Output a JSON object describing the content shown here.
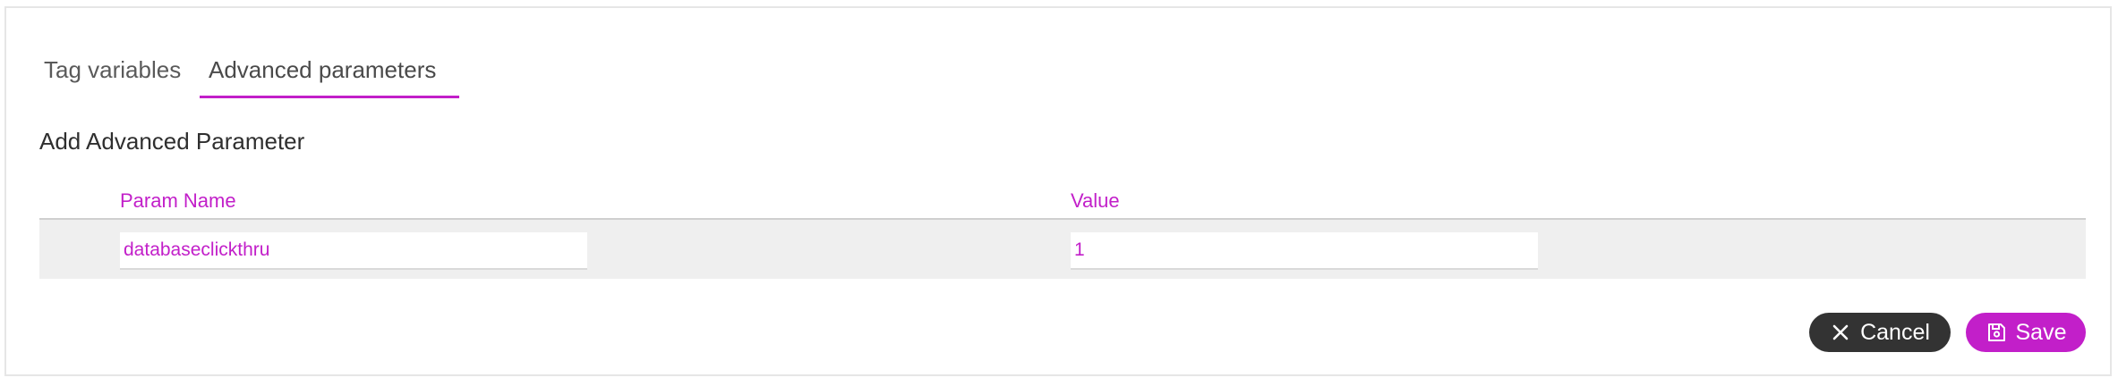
{
  "tabs": [
    {
      "label": "Tag variables",
      "active": false
    },
    {
      "label": "Advanced parameters",
      "active": true
    }
  ],
  "section": {
    "title": "Add Advanced Parameter"
  },
  "table": {
    "columns": [
      "Param Name",
      "Value"
    ],
    "rows": [
      {
        "param_name": "databaseclickthru",
        "value": "1"
      }
    ]
  },
  "actions": {
    "cancel_label": "Cancel",
    "save_label": "Save"
  },
  "icons": {
    "cancel": "close-icon",
    "save": "save-icon"
  },
  "colors": {
    "accent": "#c21fc9",
    "cancel_bg": "#333333",
    "row_bg": "#efefef"
  }
}
